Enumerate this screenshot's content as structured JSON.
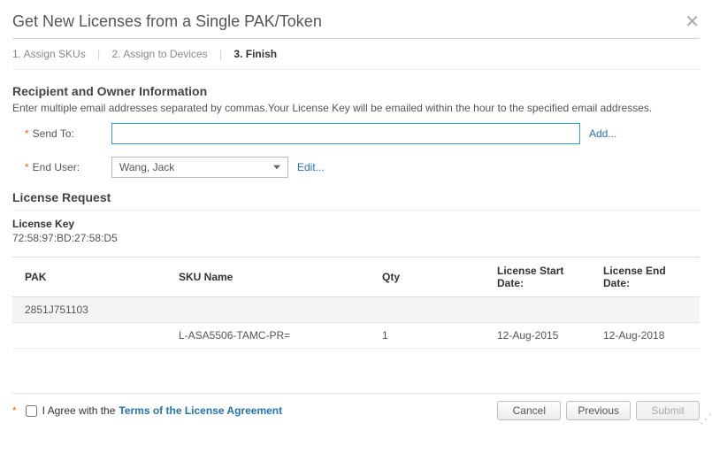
{
  "header": {
    "title": "Get New Licenses from a Single PAK/Token"
  },
  "steps": {
    "s1": "1. Assign SKUs",
    "s2": "2. Assign to Devices",
    "s3": "3. Finish"
  },
  "recipient": {
    "section_title": "Recipient and Owner Information",
    "hint": "Enter multiple email addresses separated by commas.Your License Key will be emailed within the hour to the specified email addresses.",
    "send_to_label": "Send To:",
    "send_to_value": "",
    "add_link": "Add...",
    "end_user_label": "End User:",
    "end_user_value": "Wang, Jack",
    "edit_link": "Edit..."
  },
  "license_request": {
    "section_title": "License Request",
    "key_label": "License Key",
    "key_value": "72:58:97:BD:27:58:D5",
    "columns": {
      "pak": "PAK",
      "sku": "SKU Name",
      "qty": "Qty",
      "start": "License Start Date:",
      "end": "License End Date:"
    },
    "pak_row": {
      "pak": "2851J751103"
    },
    "sku_row": {
      "sku": "L-ASA5506-TAMC-PR=",
      "qty": "1",
      "start": "12-Aug-2015",
      "end": "12-Aug-2018"
    }
  },
  "footer": {
    "agree_prefix": "I Agree with the ",
    "agree_link": "Terms of the License Agreement",
    "cancel": "Cancel",
    "previous": "Previous",
    "submit": "Submit"
  }
}
